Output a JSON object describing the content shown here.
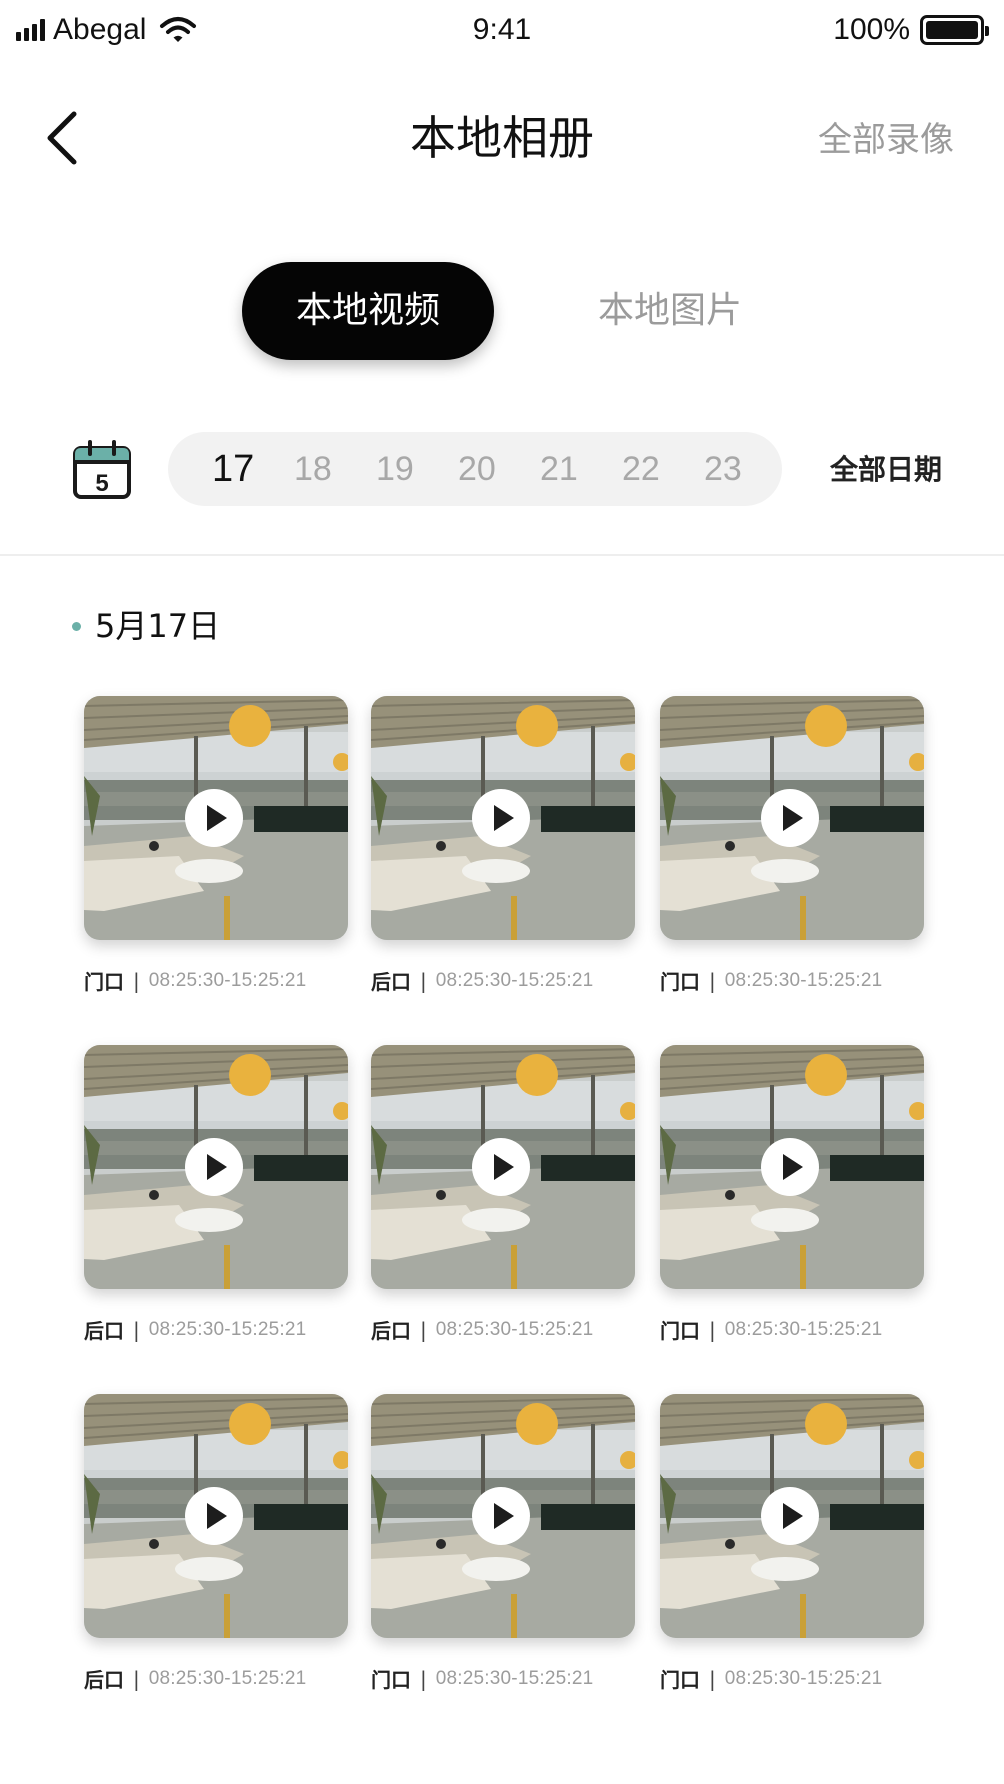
{
  "status_bar": {
    "carrier": "Abegal",
    "time": "9:41",
    "battery": "100%"
  },
  "nav": {
    "title": "本地相册",
    "action": "全部录像",
    "back_icon": "chevron-left-icon"
  },
  "tabs": {
    "active": "本地视频",
    "inactive": "本地图片"
  },
  "calendar": {
    "icon_day": "5",
    "days": [
      "17",
      "18",
      "19",
      "20",
      "21",
      "22",
      "23"
    ],
    "selected_day": "17",
    "all_dates": "全部日期"
  },
  "colors": {
    "accent_dot": "#6bb0a8",
    "tab_active_bg": "#050505",
    "muted_text": "#9b9b9b"
  },
  "section": {
    "title": "5月17日"
  },
  "videos": [
    {
      "camera": "门口",
      "time": "08:25:30-15:25:21"
    },
    {
      "camera": "后口",
      "time": "08:25:30-15:25:21"
    },
    {
      "camera": "门口",
      "time": "08:25:30-15:25:21"
    },
    {
      "camera": "后口",
      "time": "08:25:30-15:25:21"
    },
    {
      "camera": "后口",
      "time": "08:25:30-15:25:21"
    },
    {
      "camera": "门口",
      "time": "08:25:30-15:25:21"
    },
    {
      "camera": "后口",
      "time": "08:25:30-15:25:21"
    },
    {
      "camera": "门口",
      "time": "08:25:30-15:25:21"
    },
    {
      "camera": "门口",
      "time": "08:25:30-15:25:21"
    }
  ],
  "separator": "|"
}
